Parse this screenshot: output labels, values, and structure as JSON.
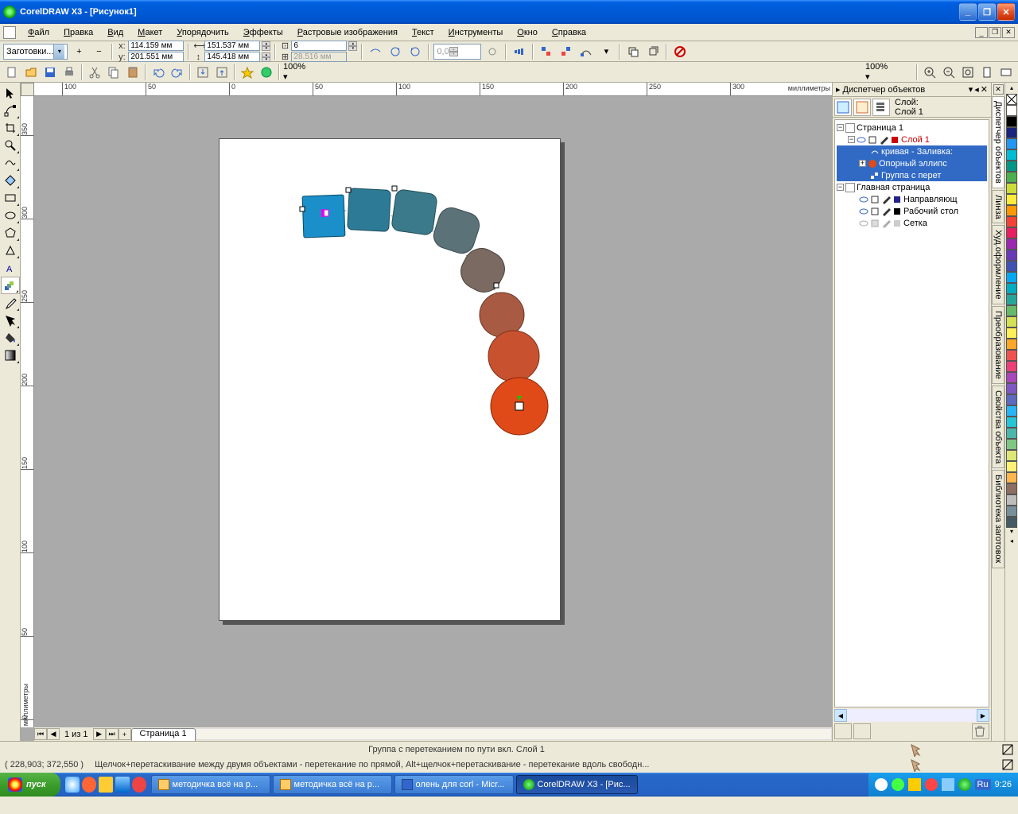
{
  "title": "CorelDRAW X3 - [Рисунок1]",
  "menu": {
    "file": "Файл",
    "edit": "Правка",
    "view": "Вид",
    "layout": "Макет",
    "arrange": "Упорядочить",
    "effects": "Эффекты",
    "bitmaps": "Растровые изображения",
    "text": "Текст",
    "tools": "Инструменты",
    "window": "Окно",
    "help": "Справка"
  },
  "propbar": {
    "preset": "Заготовки...",
    "x": "114.159 мм",
    "y": "201.551 мм",
    "w": "151.537 мм",
    "h": "145.418 мм",
    "steps": "6",
    "dist": "28.516 мм",
    "offset": "0,0"
  },
  "stdbar": {
    "zoom": "100%"
  },
  "ruler": {
    "unit": "миллиметры",
    "h": [
      "100",
      "50",
      "0",
      "50",
      "100",
      "150",
      "200",
      "250",
      "300"
    ],
    "v": [
      "350",
      "300",
      "250",
      "200",
      "150",
      "100",
      "50",
      "0"
    ]
  },
  "pagenav": {
    "info": "1 из 1",
    "tab": "Страница 1"
  },
  "docker": {
    "title": "Диспетчер объектов",
    "layer_lbl": "Слой:",
    "layer_name": "Слой 1",
    "tree": {
      "page": "Страница 1",
      "layer1": "Слой 1",
      "curve": "кривая - Заливка:",
      "ellipse": "Опорный эллипс",
      "group": "Группа с перет",
      "master": "Главная страница",
      "guides": "Направляющ",
      "desktop": "Рабочий стол",
      "grid": "Сетка"
    }
  },
  "vtabs": [
    "Линза",
    "Худ.оформление",
    "Преобразование",
    "Свойства объекта",
    "Библиотека заготовок",
    "Диспетчер объектов"
  ],
  "palette": [
    "#ffffff",
    "#000000",
    "#1a237e",
    "#2196f3",
    "#00bcd4",
    "#009688",
    "#4caf50",
    "#cddc39",
    "#ffeb3b",
    "#ff9800",
    "#f44336",
    "#e91e63",
    "#9c27b0",
    "#673ab7",
    "#3f51b5",
    "#03a9f4",
    "#00acc1",
    "#26a69a",
    "#66bb6a",
    "#d4e157",
    "#ffee58",
    "#ffa726",
    "#ef5350",
    "#ec407a",
    "#ab47bc",
    "#7e57c2",
    "#5c6bc0",
    "#29b6f6",
    "#26c6da",
    "#4db6ac",
    "#81c784",
    "#dce775",
    "#fff176",
    "#ffb74d",
    "#8d6e63",
    "#bdbdbd",
    "#78909c",
    "#455a64"
  ],
  "status1": "Группа с перетеканием по пути вкл. Слой 1",
  "status2_coords": "( 228,903; 372,550 )",
  "status2_hint": "Щелчок+перетаскивание между двумя объектами - перетекание по прямой, Alt+щелчок+перетаскивание - перетекание вдоль свободн...",
  "taskbar": {
    "start": "пуск",
    "btn1": "методичка всё на р...",
    "btn2": "методичка всё на р...",
    "btn3": "олень для corl - Micr...",
    "btn4": "CorelDRAW X3 - [Рис...",
    "lang": "Ru",
    "time": "9:26"
  }
}
